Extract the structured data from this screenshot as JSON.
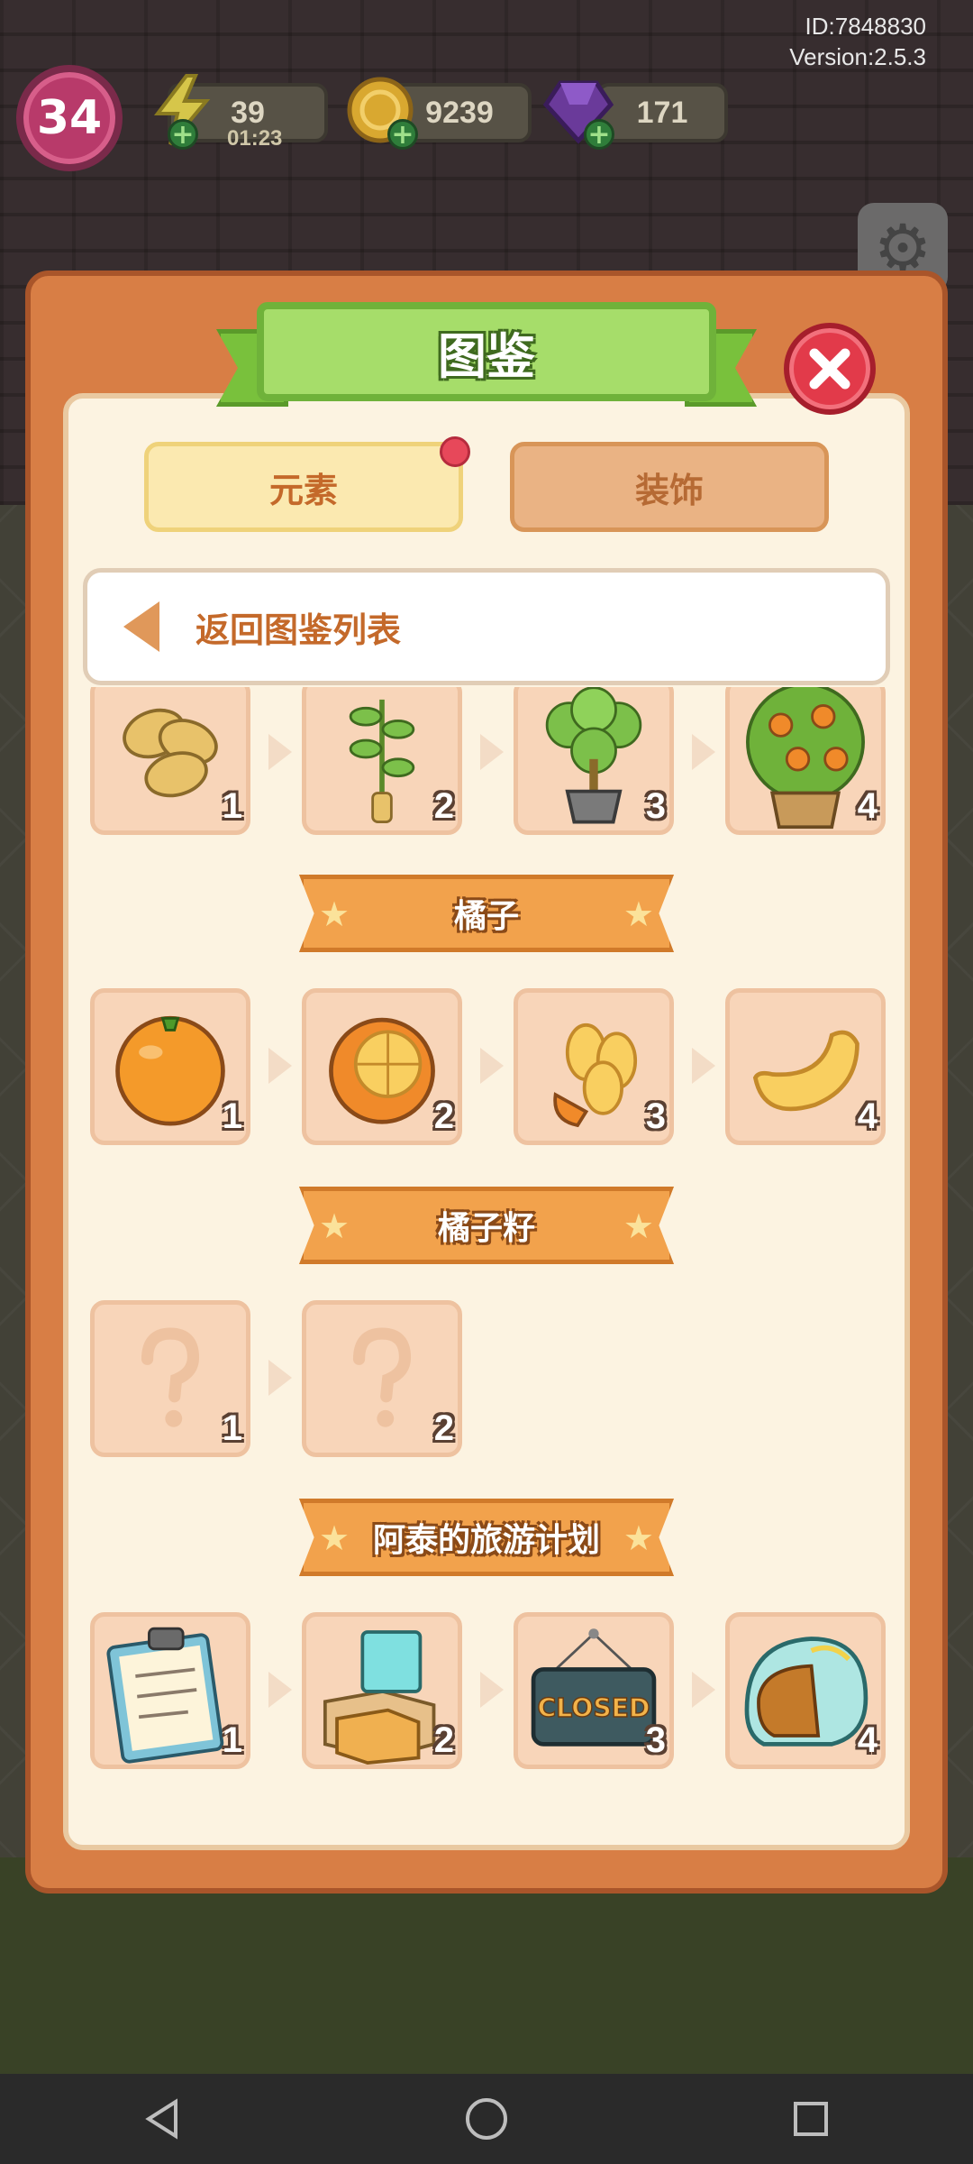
{
  "hud": {
    "id_text": "ID:7848830",
    "version_text": "Version:2.5.3",
    "level": "34",
    "energy": "39",
    "energy_timer": "01:23",
    "coins": "9239",
    "gems": "171"
  },
  "modal": {
    "title": "图鉴",
    "tabs": [
      {
        "label": "元素",
        "active": true,
        "has_notification": true
      },
      {
        "label": "装饰",
        "active": false
      }
    ],
    "back_label": "返回图鉴列表",
    "top_partial_row": [
      {
        "level": "1",
        "icon": "seeds-icon"
      },
      {
        "level": "2",
        "icon": "sapling-icon"
      },
      {
        "level": "3",
        "icon": "potted-plant-icon"
      },
      {
        "level": "4",
        "icon": "orange-tree-icon"
      }
    ],
    "sections": [
      {
        "title": "橘子",
        "items": [
          {
            "level": "1",
            "icon": "orange-icon"
          },
          {
            "level": "2",
            "icon": "peeled-orange-icon"
          },
          {
            "level": "3",
            "icon": "orange-segments-icon"
          },
          {
            "level": "4",
            "icon": "orange-slice-icon"
          }
        ]
      },
      {
        "title": "橘子籽",
        "items": [
          {
            "level": "1",
            "icon": "unknown-icon",
            "locked": true
          },
          {
            "level": "2",
            "icon": "unknown-icon",
            "locked": true
          }
        ]
      },
      {
        "title": "阿泰的旅游计划",
        "items": [
          {
            "level": "1",
            "icon": "clipboard-icon"
          },
          {
            "level": "2",
            "icon": "boxes-icon"
          },
          {
            "level": "3",
            "icon": "closed-sign-icon",
            "sign_text": "CLOSED"
          },
          {
            "level": "4",
            "icon": "helmet-icon"
          }
        ]
      }
    ]
  },
  "colors": {
    "modal_frame": "#d87e45",
    "panel": "#fcf3e1",
    "title_green": "#a6dd6a",
    "banner_orange": "#f2a24c",
    "card_bg": "#f8d5b9",
    "close_red": "#e23a4a"
  }
}
